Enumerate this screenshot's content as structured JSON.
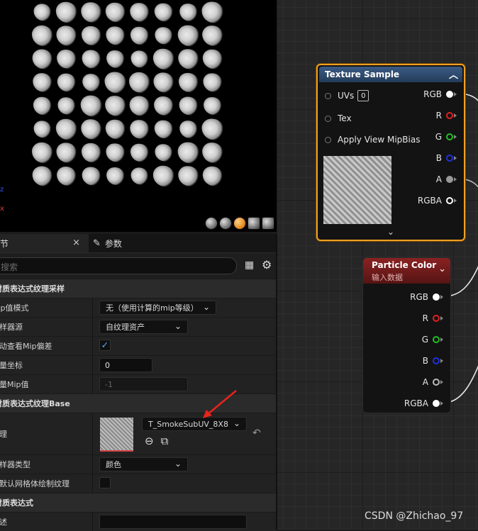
{
  "viewport": {
    "axis_z": "z",
    "axis_x": "x",
    "preview_shapes": [
      "cylinder-icon",
      "sphere-icon",
      "plane-icon",
      "cube-icon",
      "custom-mesh-icon"
    ]
  },
  "details": {
    "tab_details": "细节",
    "tab_params": "参数",
    "search_placeholder": "搜索",
    "sections": {
      "sample_title": "材质表达式纹理采样",
      "base_title": "材质表达式纹理Base",
      "expr_title": "材质表达式"
    },
    "rows": {
      "mip_mode_label": "Mip值模式",
      "mip_mode_value": "无（使用计算的mip等级）",
      "sampler_source_label": "采样器源",
      "sampler_source_value": "自纹理资产",
      "auto_view_mip_label": "自动查看Mip偏差",
      "const_coord_label": "常量坐标",
      "const_coord_value": "0",
      "const_mip_label": "常量Mip值",
      "const_mip_value": "-1",
      "texture_label": "纹理",
      "texture_value": "T_SmokeSubUV_8X8",
      "sampler_type_label": "采样器类型",
      "sampler_type_value": "颜色",
      "default_mesh_label": "由默认网格体绘制纹理",
      "desc_label": "描述"
    }
  },
  "graph": {
    "texture_sample": {
      "title": "Texture Sample",
      "inputs": [
        "UVs",
        "Tex",
        "Apply View MipBias"
      ],
      "uvs_value": "0",
      "outputs": [
        "RGB",
        "R",
        "G",
        "B",
        "A",
        "RGBA"
      ]
    },
    "particle_color": {
      "title": "Particle Color",
      "subtitle": "输入数据",
      "outputs": [
        "RGB",
        "R",
        "G",
        "B",
        "A",
        "RGBA"
      ]
    }
  },
  "watermark": "CSDN @Zhichao_97",
  "colors": {
    "accent_orange": "#f0a021",
    "pin_red": "#e02020",
    "pin_green": "#20c020",
    "pin_blue": "#2030e0"
  }
}
